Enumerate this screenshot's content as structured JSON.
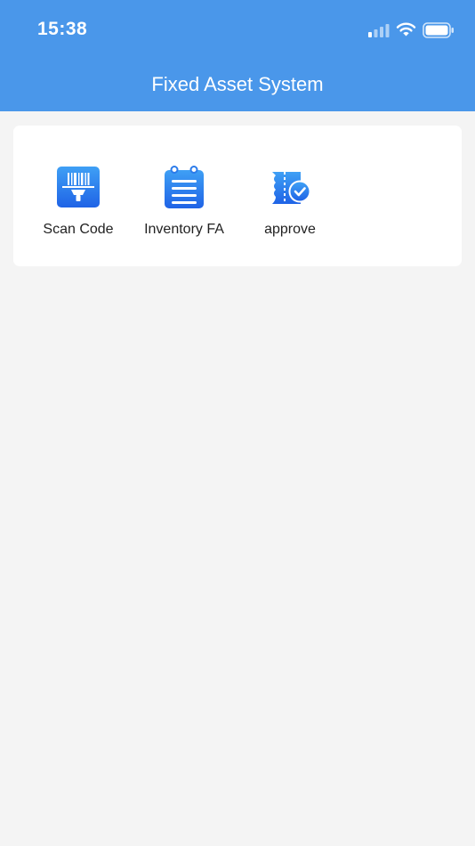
{
  "status_bar": {
    "time": "15:38",
    "icons": [
      "cellular-signal-icon",
      "wifi-icon",
      "battery-icon"
    ]
  },
  "nav": {
    "title": "Fixed Asset System"
  },
  "menu": {
    "items": [
      {
        "label": "Scan Code",
        "icon": "barcode-scan-icon"
      },
      {
        "label": "Inventory FA",
        "icon": "clipboard-list-icon"
      },
      {
        "label": "approve",
        "icon": "approve-check-icon"
      }
    ]
  },
  "colors": {
    "header": "#4a97ea",
    "icon_gradient_top": "#3fa0f5",
    "icon_gradient_bottom": "#1f63e6",
    "background": "#f4f4f4",
    "card": "#ffffff"
  }
}
